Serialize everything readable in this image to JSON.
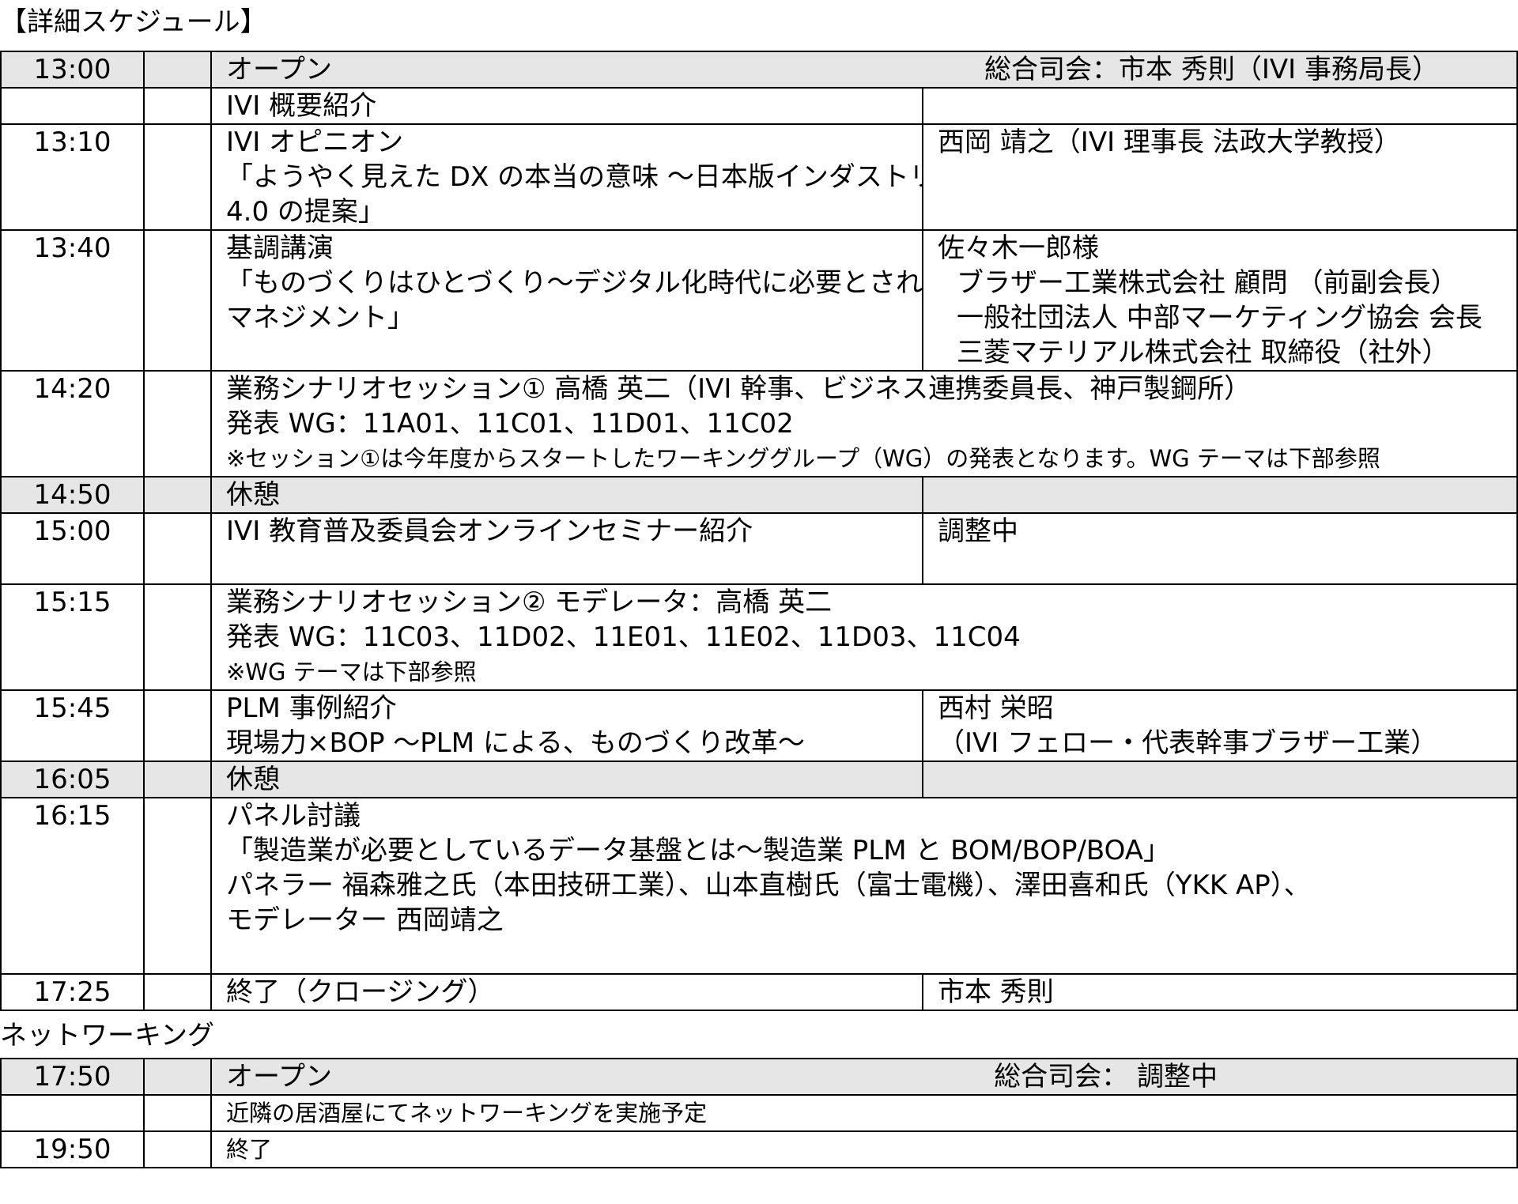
{
  "title": "【詳細スケジュール】",
  "schedule": [
    {
      "time": "13:00",
      "program_lines": [
        "オープン"
      ],
      "chair": "総合司会：市本 秀則（IVI 事務局長）"
    },
    {
      "time": "",
      "program_lines": [
        "IVI 概要紹介"
      ],
      "speaker_lines": [
        ""
      ]
    },
    {
      "time": "13:10",
      "program_lines": [
        "IVI オピニオン",
        "「ようやく見えた DX の本当の意味 ～日本版インダストリー",
        "4.0 の提案」"
      ],
      "speaker_lines": [
        "西岡 靖之（IVI 理事長 法政大学教授）"
      ]
    },
    {
      "time": "13:40",
      "program_lines": [
        "基調講演",
        "「ものづくりはひとづくり～デジタル化時代に必要とされる人財",
        "マネジメント」"
      ],
      "speaker_lines": [
        "佐々木一郎様",
        "ブラザー工業株式会社 顧問 （前副会長）",
        "一般社団法人 中部マーケティング協会 会長",
        "三菱マテリアル株式会社 取締役（社外）"
      ]
    },
    {
      "time": "14:20",
      "program_lines": [
        "業務シナリオセッション① 高橋 英二（IVI 幹事、ビジネス連携委員長、神戸製鋼所）",
        "発表 WG：11A01、11C01、11D01、11C02"
      ],
      "note": "※セッション①は今年度からスタートしたワーキンググループ（WG）の発表となります。WG テーマは下部参照"
    },
    {
      "time": "14:50",
      "program_lines": [
        "休憩"
      ],
      "speaker_lines": [
        ""
      ]
    },
    {
      "time": "15:00",
      "program_lines": [
        "IVI 教育普及委員会オンラインセミナー紹介"
      ],
      "speaker_lines": [
        "調整中"
      ]
    },
    {
      "time": "15:15",
      "program_lines": [
        "業務シナリオセッション② モデレータ：高橋 英二",
        "発表 WG：11C03、11D02、11E01、11E02、11D03、11C04"
      ],
      "note": "※WG テーマは下部参照"
    },
    {
      "time": "15:45",
      "program_lines": [
        "PLM 事例紹介",
        "現場力×BOP ～PLM による、ものづくり改革～"
      ],
      "speaker_lines": [
        "西村 栄昭",
        "（IVI フェロー・代表幹事ブラザー工業）"
      ]
    },
    {
      "time": "16:05",
      "program_lines": [
        "休憩"
      ],
      "speaker_lines": [
        ""
      ]
    },
    {
      "time": "16:15",
      "program_lines": [
        "パネル討議",
        "「製造業が必要としているデータ基盤とは～製造業 PLM と BOM/BOP/BOA」",
        "パネラー 福森雅之氏（本田技研工業）、山本直樹氏（富士電機）、澤田喜和氏（YKK AP）、",
        "モデレーター 西岡靖之"
      ]
    },
    {
      "time": "17:25",
      "program_lines": [
        "終了（クロージング）"
      ],
      "speaker_lines": [
        "市本 秀則"
      ]
    }
  ],
  "networking_title": "ネットワーキング",
  "networking": [
    {
      "time": "17:50",
      "program_lines": [
        "オープン"
      ],
      "chair": "総合司会： 調整中"
    },
    {
      "time": "",
      "program": "近隣の居酒屋にてネットワーキングを実施予定"
    },
    {
      "time": "19:50",
      "program": "終了"
    }
  ]
}
